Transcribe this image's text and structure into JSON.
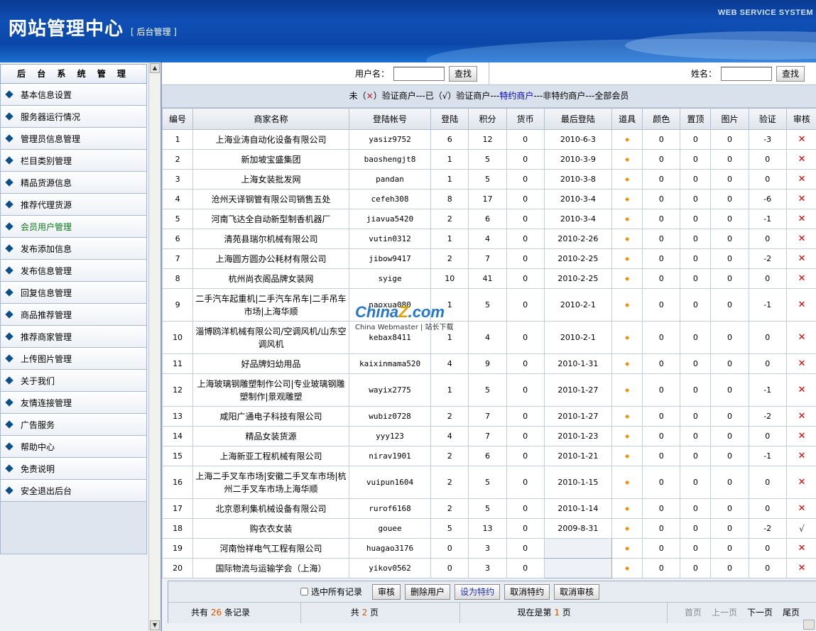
{
  "header": {
    "title": "网站管理中心",
    "subtitle": "[ 后台管理 ]",
    "system": "WEB SERVICE SYSTEM"
  },
  "sidebar": {
    "title": "后 台 系 统 管 理",
    "items": [
      {
        "label": "基本信息设置"
      },
      {
        "label": "服务器运行情况"
      },
      {
        "label": "管理员信息管理"
      },
      {
        "label": "栏目类别管理"
      },
      {
        "label": "精品货源信息"
      },
      {
        "label": "推荐代理货源"
      },
      {
        "label": "会员用户管理"
      },
      {
        "label": "发布添加信息"
      },
      {
        "label": "发布信息管理"
      },
      {
        "label": "回复信息管理"
      },
      {
        "label": "商品推荐管理"
      },
      {
        "label": "推荐商家管理"
      },
      {
        "label": "上传图片管理"
      },
      {
        "label": "关于我们"
      },
      {
        "label": "友情连接管理"
      },
      {
        "label": "广告服务"
      },
      {
        "label": "帮助中心"
      },
      {
        "label": "免责说明"
      },
      {
        "label": "安全退出后台"
      }
    ],
    "active_index": 6
  },
  "search": {
    "username_label": "用户名：",
    "name_label": "姓名：",
    "button": "查找"
  },
  "legend": {
    "p1": "未（",
    "x": "×",
    "p2": "）验证商户---已（√）验证商户---",
    "special": "特约商户",
    "p3": "---非特约商户---全部会员"
  },
  "table": {
    "headers": [
      "编号",
      "商家名称",
      "登陆帐号",
      "登陆",
      "积分",
      "货币",
      "最后登陆",
      "道具",
      "颜色",
      "置顶",
      "图片",
      "验证",
      "审核"
    ],
    "rows": [
      [
        "1",
        "上海业涛自动化设备有限公司",
        "yasiz9752",
        "6",
        "12",
        "0",
        "2010-6-3",
        "◆",
        "0",
        "0",
        "0",
        "-3",
        "✕"
      ],
      [
        "2",
        "新加坡宝盛集团",
        "baoshengjt8",
        "1",
        "5",
        "0",
        "2010-3-9",
        "◆",
        "0",
        "0",
        "0",
        "0",
        "✕"
      ],
      [
        "3",
        "上海女装批发网",
        "pandan",
        "1",
        "5",
        "0",
        "2010-3-8",
        "◆",
        "0",
        "0",
        "0",
        "0",
        "✕"
      ],
      [
        "4",
        "沧州天译钢管有限公司销售五处",
        "cefeh308",
        "8",
        "17",
        "0",
        "2010-3-4",
        "◆",
        "0",
        "0",
        "0",
        "-6",
        "✕"
      ],
      [
        "5",
        "河南飞达全自动新型制香机器厂",
        "jiavua5420",
        "2",
        "6",
        "0",
        "2010-3-4",
        "◆",
        "0",
        "0",
        "0",
        "-1",
        "✕"
      ],
      [
        "6",
        "清苑县瑞尔机械有限公司",
        "vutin0312",
        "1",
        "4",
        "0",
        "2010-2-26",
        "◆",
        "0",
        "0",
        "0",
        "0",
        "✕"
      ],
      [
        "7",
        "上海圆方圆办公耗材有限公司",
        "jibow9417",
        "2",
        "7",
        "0",
        "2010-2-25",
        "◆",
        "0",
        "0",
        "0",
        "-2",
        "✕"
      ],
      [
        "8",
        "杭州尚衣阁品牌女装网",
        "syige",
        "10",
        "41",
        "0",
        "2010-2-25",
        "◆",
        "0",
        "0",
        "0",
        "0",
        "✕"
      ],
      [
        "9",
        "二手汽车起重机|二手汽车吊车|二手吊车市场|上海华顺",
        "naoxua080",
        "1",
        "5",
        "0",
        "2010-2-1",
        "◆",
        "0",
        "0",
        "0",
        "-1",
        "✕"
      ],
      [
        "10",
        "淄博鸥洋机械有限公司/空调风机/山东空调风机",
        "kebax8411",
        "1",
        "4",
        "0",
        "2010-2-1",
        "◆",
        "0",
        "0",
        "0",
        "0",
        "✕"
      ],
      [
        "11",
        "好品牌妇幼用品",
        "kaixinmama520",
        "4",
        "9",
        "0",
        "2010-1-31",
        "◆",
        "0",
        "0",
        "0",
        "0",
        "✕"
      ],
      [
        "12",
        "上海玻璃钢雕塑制作公司|专业玻璃钢雕塑制作|景观雕塑",
        "wayix2775",
        "1",
        "5",
        "0",
        "2010-1-27",
        "◆",
        "0",
        "0",
        "0",
        "-1",
        "✕"
      ],
      [
        "13",
        "咸阳广通电子科技有限公司",
        "wubiz0728",
        "2",
        "7",
        "0",
        "2010-1-27",
        "◆",
        "0",
        "0",
        "0",
        "-2",
        "✕"
      ],
      [
        "14",
        "精品女装货源",
        "yyy123",
        "4",
        "7",
        "0",
        "2010-1-23",
        "◆",
        "0",
        "0",
        "0",
        "0",
        "✕"
      ],
      [
        "15",
        "上海新亚工程机械有限公司",
        "nirav1901",
        "2",
        "6",
        "0",
        "2010-1-21",
        "◆",
        "0",
        "0",
        "0",
        "-1",
        "✕"
      ],
      [
        "16",
        "上海二手叉车市场|安徽二手叉车市场|杭州二手叉车市场上海华顺",
        "vuipun1604",
        "2",
        "5",
        "0",
        "2010-1-15",
        "◆",
        "0",
        "0",
        "0",
        "0",
        "✕"
      ],
      [
        "17",
        "北京恩利集机械设备有限公司",
        "rurof6168",
        "2",
        "5",
        "0",
        "2010-1-14",
        "◆",
        "0",
        "0",
        "0",
        "0",
        "✕"
      ],
      [
        "18",
        "购衣衣女装",
        "gouee",
        "5",
        "13",
        "0",
        "2009-8-31",
        "◆",
        "0",
        "0",
        "0",
        "-2",
        "√"
      ],
      [
        "19",
        "河南怡祥电气工程有限公司",
        "huagao3176",
        "0",
        "3",
        "0",
        "",
        "◆",
        "0",
        "0",
        "0",
        "0",
        "✕"
      ],
      [
        "20",
        "国际物流与运输学会（上海）",
        "yikov0562",
        "0",
        "3",
        "0",
        "",
        "◆",
        "0",
        "0",
        "0",
        "0",
        "✕"
      ]
    ]
  },
  "actions": {
    "select_all": "选中所有记录",
    "buttons": [
      "审核",
      "删除用户",
      "设为特约",
      "取消特约",
      "取消审核"
    ]
  },
  "pager": {
    "total_prefix": "共有",
    "total": "26",
    "total_suffix": "条记录",
    "pages_prefix": "共",
    "pages": "2",
    "pages_suffix": "页",
    "current_prefix": "现在是第",
    "current": "1",
    "current_suffix": "页",
    "first": "首页",
    "prev": "上一页",
    "next": "下一页",
    "last": "尾页"
  },
  "watermark": {
    "main": "China",
    "z": "Z",
    "suffix": ".com",
    "sub": "China Webmaster | 站长下载"
  },
  "colors": {
    "header": "#0b47a8",
    "accent": "#f28c00",
    "reject": "#d40000",
    "active_menu": "#0a7a18"
  },
  "icons": {
    "tool": "diamond-icon",
    "reject": "cross-icon",
    "approve": "check-icon",
    "menu": "diamond-bullet-icon"
  }
}
